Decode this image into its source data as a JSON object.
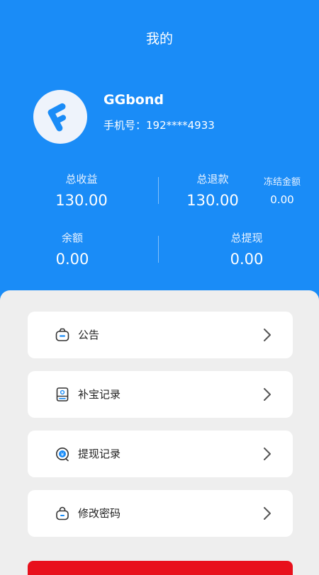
{
  "header": {
    "title": "我的"
  },
  "profile": {
    "username": "GGbond",
    "phone": "手机号：192****4933"
  },
  "stats": {
    "total_income_label": "总收益",
    "total_income_value": "130.00",
    "total_refund_label": "总退款",
    "total_refund_value": "130.00",
    "frozen_label": "冻结金额",
    "frozen_value": "0.00",
    "balance_label": "余额",
    "balance_value": "0.00",
    "total_withdraw_label": "总提现",
    "total_withdraw_value": "0.00"
  },
  "menu": {
    "items": [
      {
        "label": "公告",
        "icon": "announcement-icon"
      },
      {
        "label": "补宝记录",
        "icon": "record-icon"
      },
      {
        "label": "提现记录",
        "icon": "withdraw-icon"
      },
      {
        "label": "修改密码",
        "icon": "lock-icon"
      }
    ]
  },
  "colors": {
    "primary": "#1a8cf7",
    "danger": "#e8101c",
    "background": "#eeeeee"
  }
}
